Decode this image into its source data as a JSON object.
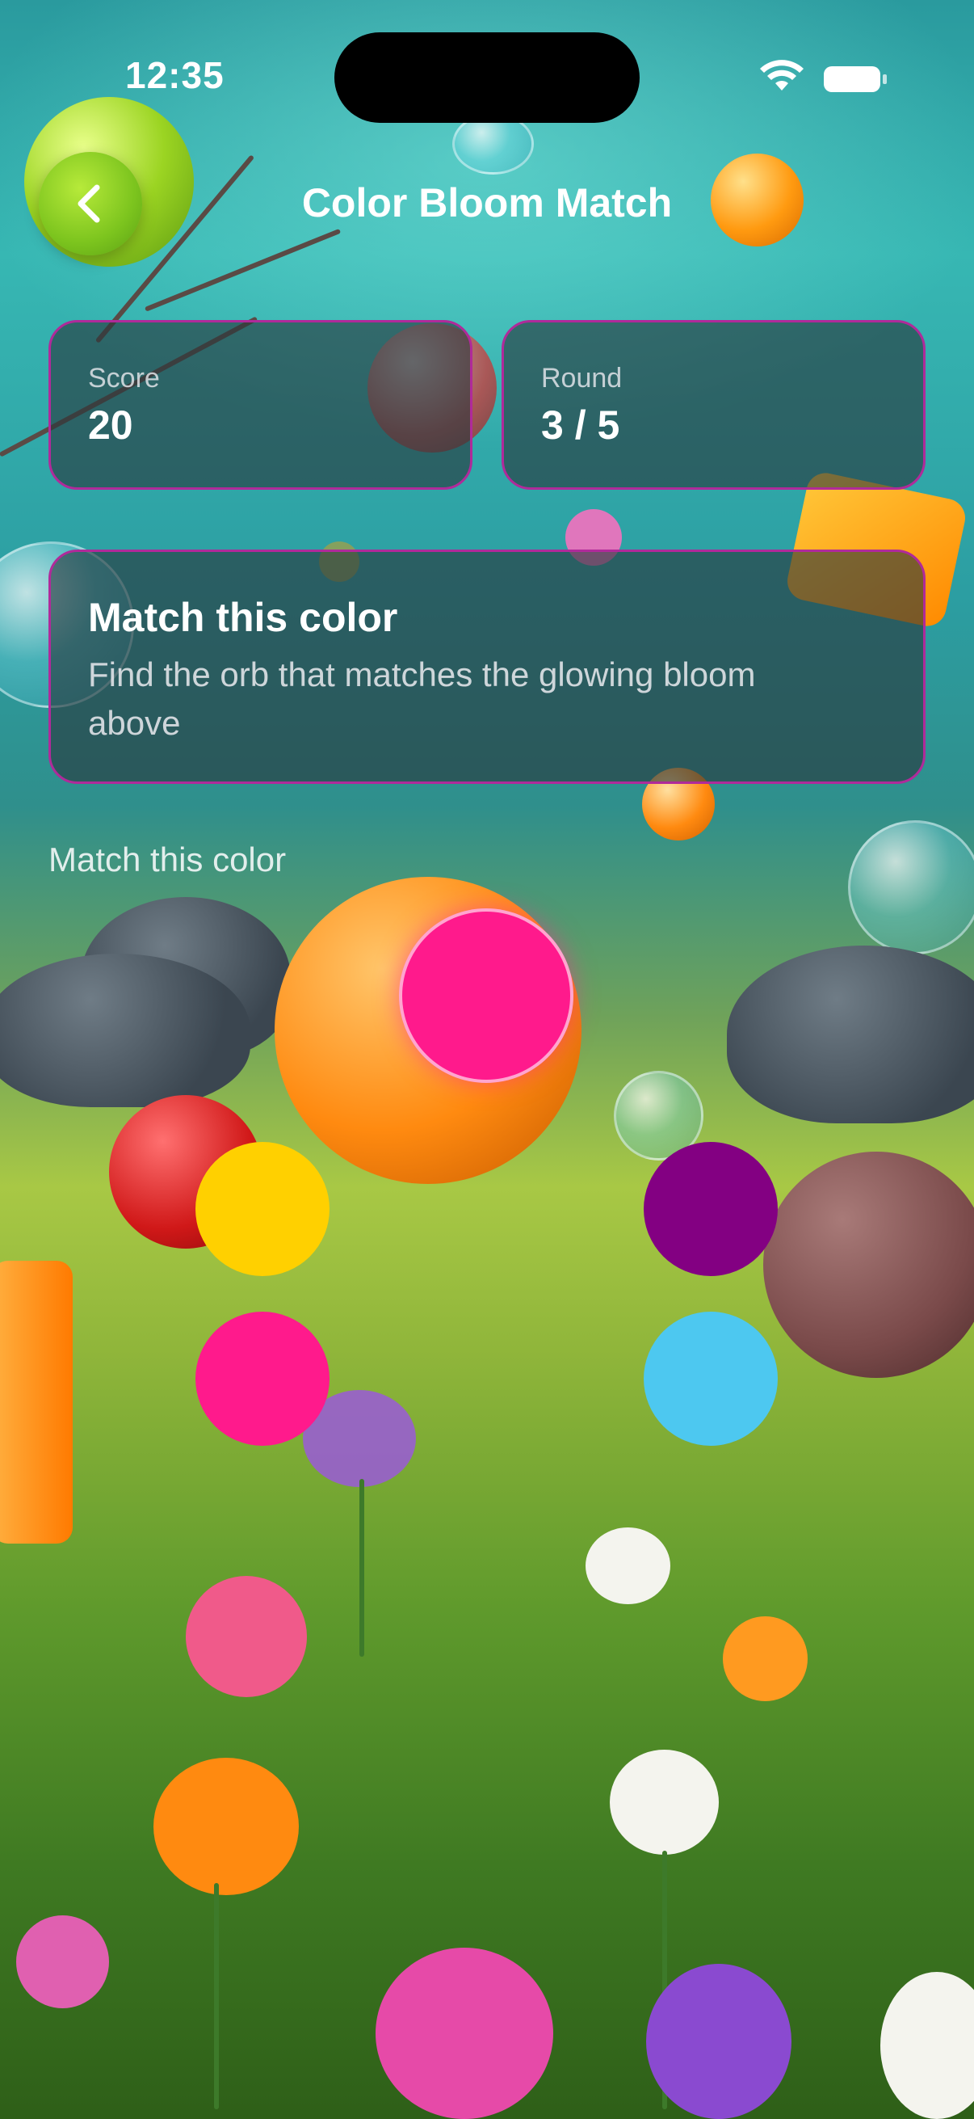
{
  "status_bar": {
    "time": "12:35",
    "icons": [
      "wifi-icon",
      "battery-icon"
    ]
  },
  "nav": {
    "title": "Color Bloom Match",
    "back_icon": "chevron-left-icon"
  },
  "stats": {
    "score_label": "Score",
    "score_value": "20",
    "round_label": "Round",
    "round_value": "3 / 5"
  },
  "prompt": {
    "title": "Match this color",
    "body": "Find the orb that matches the glowing bloom above"
  },
  "target": {
    "label": "Match this color",
    "color": "#FF1A8C"
  },
  "orbs": [
    {
      "name": "yellow",
      "color": "#FFD000"
    },
    {
      "name": "purple",
      "color": "#830082"
    },
    {
      "name": "pink",
      "color": "#FF1A8C"
    },
    {
      "name": "sky-blue",
      "color": "#4DC8F0"
    }
  ],
  "colors": {
    "card_border": "#B02A9A",
    "card_background": "rgba(40,55,60,0.62)",
    "back_button": "#7CC41E"
  }
}
